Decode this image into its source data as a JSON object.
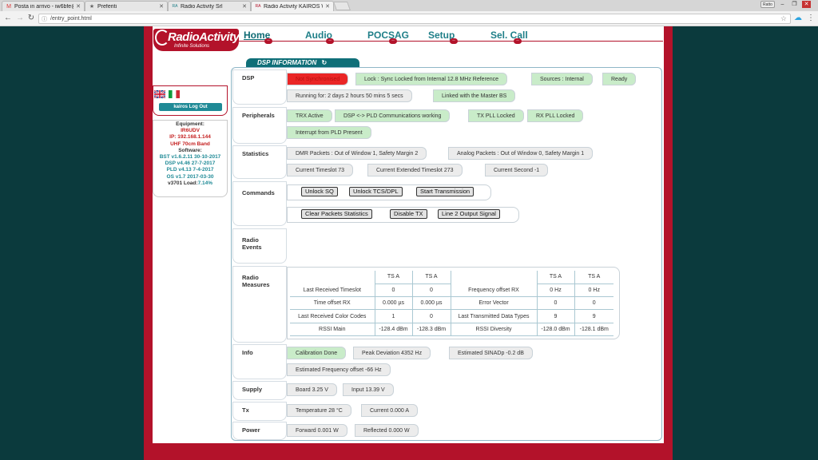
{
  "browser": {
    "tabs": [
      {
        "label": "Posta in arrivo - iw6bfe@",
        "icon": "M"
      },
      {
        "label": "Preferiti",
        "icon": "★"
      },
      {
        "label": "Radio Activity Srl",
        "icon": "RA"
      },
      {
        "label": "Radio Activity KAIROS W",
        "icon": "RA"
      }
    ],
    "user_tag": "Ratto",
    "url": "/entry_point.html"
  },
  "nav": {
    "items": [
      "Home",
      "Audio",
      "POCSAG",
      "Setup",
      "Sel. Call"
    ]
  },
  "logo": {
    "brand": "RadioActivity",
    "tagline": "Infinite Solutions"
  },
  "sidebar": {
    "logout": "kairos Log Out",
    "equipment_title": "Equipment:",
    "callsign": "IR6UDV",
    "ip": "IP: 192.168.1.144",
    "band": "UHF 70cm Band",
    "software_title": "Software:",
    "bst": "BST v1.6.2.11 30-10-2017",
    "dsp": "DSP v4.46 27-7-2017",
    "pld": "PLD v4.13 7-4-2017",
    "os": "OS v1.7 2017-03-30",
    "load_prefix": "v3701 Load:",
    "load_value": "7.14%"
  },
  "section_title": "DSP INFORMATION",
  "rows": {
    "dsp": {
      "label": "DSP",
      "items": [
        "Not Synchronised",
        "Lock : Sync Locked from Internal 12.8 MHz Reference",
        "Sources : Internal",
        "Ready",
        "Running for: 2 days 2 hours 50 mins 5 secs",
        "Linked with the Master BS"
      ]
    },
    "peripherals": {
      "label": "Peripherals",
      "items": [
        "TRX Active",
        "DSP <-> PLD Communications working",
        "TX PLL Locked",
        "RX PLL Locked",
        "Interrupt from PLD Present"
      ]
    },
    "statistics": {
      "label": "Statistics",
      "items": [
        "DMR Packets : Out of Window 1, Safety Margin 2",
        "Analog Packets : Out of Window 0, Safety Margin 1",
        "Current Timeslot 73",
        "Current Extended Timeslot 273",
        "Current Second -1"
      ]
    },
    "commands": {
      "label": "Commands",
      "buttons": [
        "Unlock SQ",
        "Unlock TCS/DPL",
        "Start Transmission",
        "Clear Packets Statistics",
        "Disable TX",
        "Line 2 Output Signal"
      ]
    },
    "radio_events": {
      "label_line1": "Radio",
      "label_line2": "Events"
    },
    "radio_measures": {
      "label_line1": "Radio",
      "label_line2": "Measures",
      "headers": [
        "TS A",
        "TS A",
        "TS A",
        "TS A"
      ],
      "rows": [
        [
          "Last Received Timeslot",
          "0",
          "0",
          "Frequency offset RX",
          "0 Hz",
          "0 Hz"
        ],
        [
          "Time offset RX",
          "0.000 µs",
          "0.000 µs",
          "Error Vector",
          "0",
          "0"
        ],
        [
          "Last Received Color Codes",
          "1",
          "0",
          "Last Transmitted Data Types",
          "9",
          "9"
        ],
        [
          "RSSI Main",
          "-128.4 dBm",
          "-128.3 dBm",
          "RSSI Diversity",
          "-128.0 dBm",
          "-128.1 dBm"
        ]
      ]
    },
    "info": {
      "label": "Info",
      "items": [
        "Calibration Done",
        "Peak Deviation 4352 Hz",
        "Estimated SINADp -0.2 dB",
        "Estimated Frequency offset -66 Hz"
      ]
    },
    "supply": {
      "label": "Supply",
      "items": [
        "Board 3.25 V",
        "Input 13.39 V"
      ]
    },
    "tx": {
      "label": "Tx",
      "items": [
        "Temperature 28 °C",
        "Current 0.000 A"
      ]
    },
    "power": {
      "label": "Power",
      "items": [
        "Forward 0.001 W",
        "Reflected 0.000 W"
      ]
    }
  }
}
